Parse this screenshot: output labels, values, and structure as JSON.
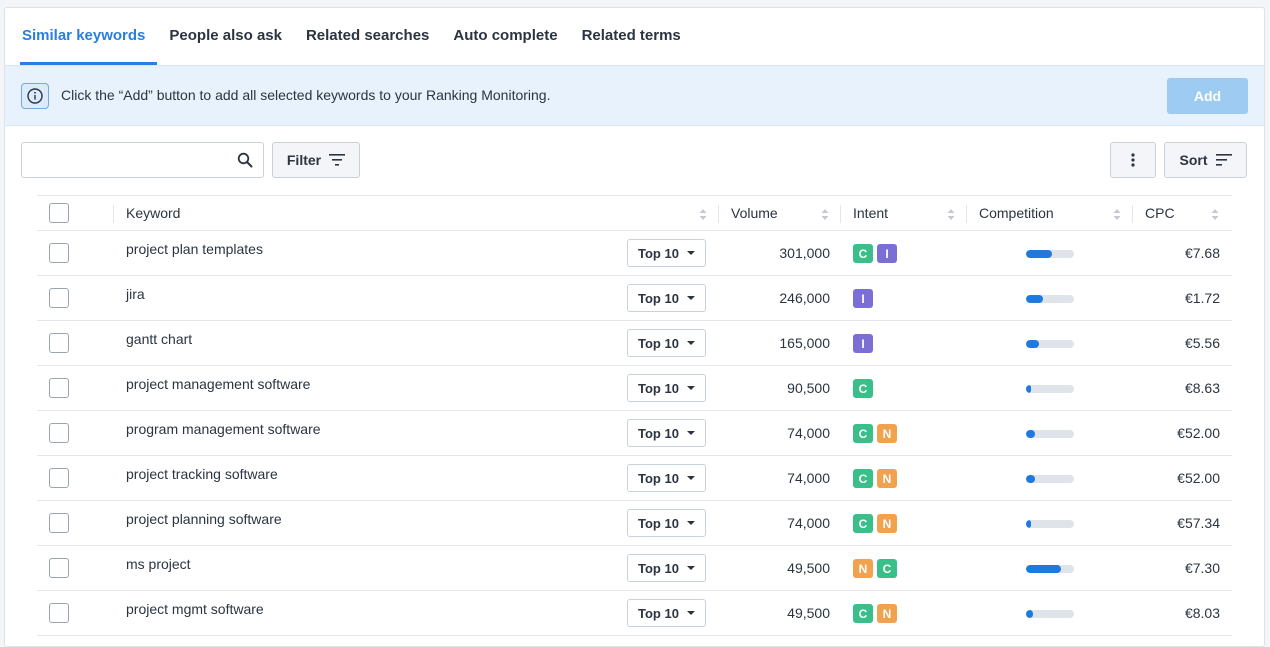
{
  "tabs": [
    {
      "label": "Similar keywords",
      "active": true
    },
    {
      "label": "People also ask",
      "active": false
    },
    {
      "label": "Related searches",
      "active": false
    },
    {
      "label": "Auto complete",
      "active": false
    },
    {
      "label": "Related terms",
      "active": false
    }
  ],
  "info": {
    "icon": "info-icon",
    "text": "Click the “Add” button to add all selected keywords to your Ranking Monitoring.",
    "add_label": "Add"
  },
  "toolbar": {
    "search_placeholder": "",
    "filter_label": "Filter",
    "sort_label": "Sort"
  },
  "table": {
    "headers": {
      "keyword": "Keyword",
      "volume": "Volume",
      "intent": "Intent",
      "competition": "Competition",
      "cpc": "CPC"
    },
    "rows": [
      {
        "keyword": "project plan templates",
        "position": "Top 10",
        "volume": "301,000",
        "intent": [
          "C",
          "I"
        ],
        "competition": 0.55,
        "cpc": "€7.68"
      },
      {
        "keyword": "jira",
        "position": "Top 10",
        "volume": "246,000",
        "intent": [
          "I"
        ],
        "competition": 0.35,
        "cpc": "€1.72"
      },
      {
        "keyword": "gantt chart",
        "position": "Top 10",
        "volume": "165,000",
        "intent": [
          "I"
        ],
        "competition": 0.27,
        "cpc": "€5.56"
      },
      {
        "keyword": "project management software",
        "position": "Top 10",
        "volume": "90,500",
        "intent": [
          "C"
        ],
        "competition": 0.1,
        "cpc": "€8.63"
      },
      {
        "keyword": "program management software",
        "position": "Top 10",
        "volume": "74,000",
        "intent": [
          "C",
          "N"
        ],
        "competition": 0.18,
        "cpc": "€52.00"
      },
      {
        "keyword": "project tracking software",
        "position": "Top 10",
        "volume": "74,000",
        "intent": [
          "C",
          "N"
        ],
        "competition": 0.18,
        "cpc": "€52.00"
      },
      {
        "keyword": "project planning software",
        "position": "Top 10",
        "volume": "74,000",
        "intent": [
          "C",
          "N"
        ],
        "competition": 0.1,
        "cpc": "€57.34"
      },
      {
        "keyword": "ms project",
        "position": "Top 10",
        "volume": "49,500",
        "intent": [
          "N",
          "C"
        ],
        "competition": 0.72,
        "cpc": "€7.30"
      },
      {
        "keyword": "project mgmt software",
        "position": "Top 10",
        "volume": "49,500",
        "intent": [
          "C",
          "N"
        ],
        "competition": 0.15,
        "cpc": "€8.03"
      }
    ]
  },
  "colors": {
    "accent": "#2a7fde",
    "intent_C": "#3bbf8a",
    "intent_I": "#7b6fd6",
    "intent_N": "#f0a24e",
    "competition_fill": "#1f7ae0"
  }
}
